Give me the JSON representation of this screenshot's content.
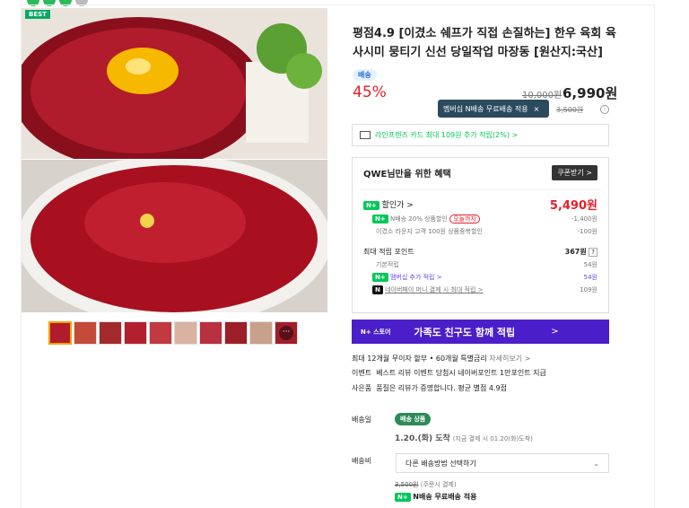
{
  "badge": "BEST",
  "product": {
    "title": "평점4.9 [이겼소 쉐프가 직접 손질하는] 한우 육회 육사시미 뭉티기 신선 당일작업 마장동 [원산지:국산]",
    "delivery_tag": "배송",
    "discount_rate": "45%",
    "original_price": "10,000원",
    "sale_price": "6,990원",
    "shipping_fee_struck": "3,500원"
  },
  "tooltip": {
    "text": "멤버십 N배송 무료배송 적용",
    "close": "×"
  },
  "card_benefit": "라인프렌즈 카드 최대 109원 추가 적립(2%) >",
  "benefit_box": {
    "title": "QWE님만을 위한 혜택",
    "coupon_button": "쿠폰받기 >",
    "discount_label": "할인가 >",
    "discount_price": "5,490원",
    "discounts": [
      {
        "label": "N배송 20% 상품할인",
        "badge": "오늘까지",
        "amount": "-1,400원"
      },
      {
        "label": "이겼소 라운지 고객 100원 상품중복할인",
        "amount": "-100원"
      }
    ],
    "points_label": "최대 적립 포인트",
    "points_value": "367원",
    "points_help": "?",
    "point_rows": [
      {
        "label": "기본적립",
        "amount": "54원"
      },
      {
        "label": "멤버십 추가 적립 >",
        "amount": "54원"
      },
      {
        "label": "네이버페이 머니 결제 시 최대 적립 >",
        "amount": "109원"
      }
    ]
  },
  "store_banner": {
    "brand": "N+ 스토어",
    "text": "가족도 친구도 함께 적립",
    "arrow": ">"
  },
  "installment": {
    "text": "최대 12개월 무이자 할부 • 60개월 특별금리",
    "link": "자세히보기 >"
  },
  "event": {
    "label": "이벤트",
    "text": "베스트 리뷰 이벤트 당첨시 네이버포인트 1만포인트 지급"
  },
  "gift": {
    "label": "사은품",
    "text": "품질은 리뷰가 증명합니다. 평균 별점 4.9점"
  },
  "delivery": {
    "label": "배송일",
    "chip": "배송 상품",
    "arrival": "1.20.(화) 도착",
    "arrival_note": "(지금 결제 시 01.20(화)도착)"
  },
  "shipping": {
    "label": "배송비",
    "select_value": "다른 배송방법 선택하기",
    "fee": "3,500원",
    "fee_note": "(주문시 결제)",
    "free": "N배송 무료배송 적용"
  },
  "colors": {
    "discount_red": "#e4202b",
    "naver_green": "#03c75a",
    "store_purple": "#4a1fc9"
  }
}
